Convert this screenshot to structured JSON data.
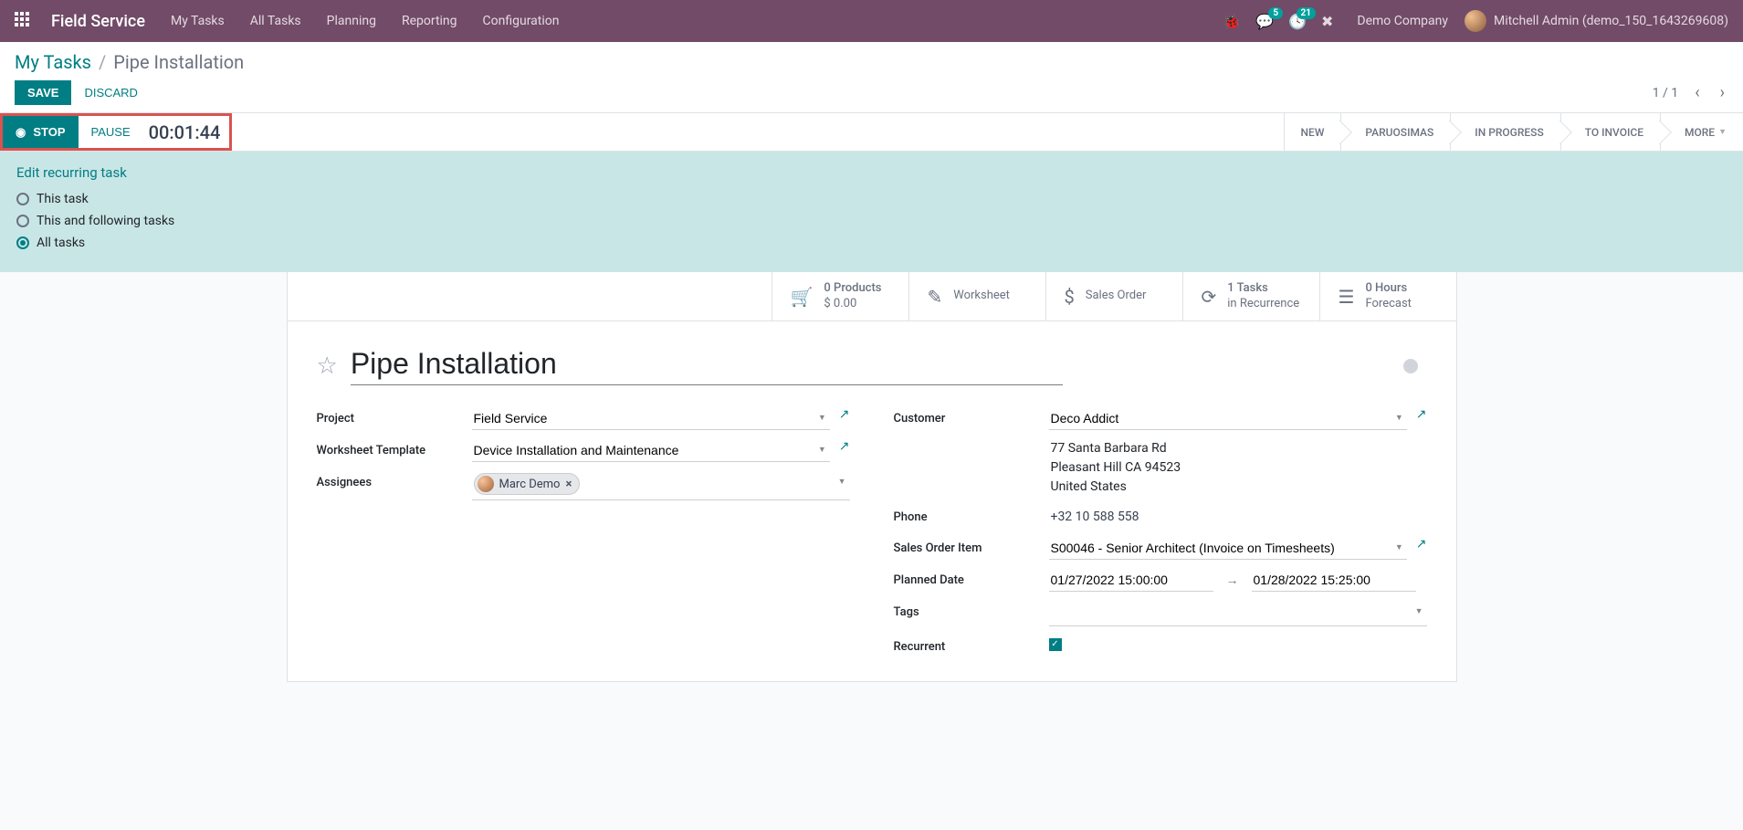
{
  "navbar": {
    "brand": "Field Service",
    "items": [
      "My Tasks",
      "All Tasks",
      "Planning",
      "Reporting",
      "Configuration"
    ],
    "msg_badge": "5",
    "activity_badge": "21",
    "company": "Demo Company",
    "user": "Mitchell Admin (demo_150_1643269608)"
  },
  "breadcrumb": {
    "parent": "My Tasks",
    "current": "Pipe Installation"
  },
  "buttons": {
    "save": "SAVE",
    "discard": "DISCARD",
    "stop": "STOP",
    "pause": "PAUSE"
  },
  "pager": {
    "text": "1 / 1"
  },
  "timer": "00:01:44",
  "stages": [
    "NEW",
    "PARUOSIMAS",
    "IN PROGRESS",
    "TO INVOICE",
    "MORE"
  ],
  "recurring": {
    "title": "Edit recurring task",
    "options": [
      "This task",
      "This and following tasks",
      "All tasks"
    ],
    "selected": 2
  },
  "stats": {
    "products": {
      "line1": "0 Products",
      "line2": "$ 0.00"
    },
    "worksheet": {
      "label": "Worksheet"
    },
    "sales": {
      "label": "Sales Order"
    },
    "recur": {
      "line1": "1 Tasks",
      "line2": "in Recurrence"
    },
    "forecast": {
      "line1": "0  Hours",
      "line2": "Forecast"
    }
  },
  "title": "Pipe Installation",
  "fields": {
    "project_label": "Project",
    "project": "Field Service",
    "wtemplate_label": "Worksheet Template",
    "wtemplate": "Device Installation and Maintenance",
    "assignees_label": "Assignees",
    "assignee_name": "Marc Demo",
    "customer_label": "Customer",
    "customer": "Deco Addict",
    "addr1": "77 Santa Barbara Rd",
    "addr2": "Pleasant Hill CA 94523",
    "addr3": "United States",
    "phone_label": "Phone",
    "phone": "+32 10 588 558",
    "soi_label": "Sales Order Item",
    "soi": "S00046 - Senior Architect (Invoice on Timesheets)",
    "planned_label": "Planned Date",
    "planned_from": "01/27/2022 15:00:00",
    "planned_to": "01/28/2022 15:25:00",
    "tags_label": "Tags",
    "recurrent_label": "Recurrent"
  }
}
